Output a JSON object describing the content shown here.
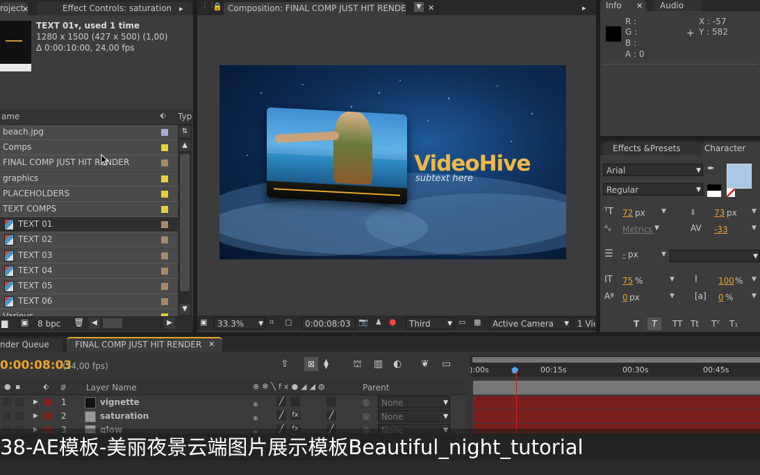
{
  "project_panel": {
    "tab_project": "roject",
    "tab_effect_controls": "Effect Controls: saturation",
    "selected_name": "TEXT 01▾, used 1 time",
    "selected_size": "1280 x 1500  (427 x 500) (1,00)",
    "selected_duration": "Δ 0:00:10:00, 24,00 fps",
    "col_name": "ame",
    "col_type": "Typ",
    "items": [
      {
        "label": "beach.jpg",
        "color": "#a9a9d8",
        "comp": false
      },
      {
        "label": "Comps",
        "color": "#e5cf3a",
        "comp": false
      },
      {
        "label": "FINAL COMP JUST HIT RENDER",
        "color": "#a88a6a",
        "comp": false
      },
      {
        "label": "graphics",
        "color": "#e5cf3a",
        "comp": false
      },
      {
        "label": "PLACEHOLDERS",
        "color": "#e5cf3a",
        "comp": false
      },
      {
        "label": "TEXT COMPS",
        "color": "#e5cf3a",
        "comp": false
      },
      {
        "label": "TEXT 01",
        "color": "#a88a6a",
        "comp": true
      },
      {
        "label": "TEXT 02",
        "color": "#a88a6a",
        "comp": true
      },
      {
        "label": "TEXT 03",
        "color": "#a88a6a",
        "comp": true
      },
      {
        "label": "TEXT 04",
        "color": "#a88a6a",
        "comp": true
      },
      {
        "label": "TEXT 05",
        "color": "#a88a6a",
        "comp": true
      },
      {
        "label": "TEXT 06",
        "color": "#a88a6a",
        "comp": true
      },
      {
        "label": "Various",
        "color": "#e5cf3a",
        "comp": false
      }
    ],
    "bpc_label": "8 bpc"
  },
  "composition_panel": {
    "tab_label": "Composition: FINAL COMP JUST HIT RENDER",
    "preview_title": "VideoHive",
    "preview_subtitle": "subtext here",
    "zoom": "33.3%",
    "timecode": "0:00:08:03",
    "resolution": "Third",
    "camera": "Active Camera",
    "views": "1 Vie"
  },
  "info_panel": {
    "tab_info": "Info",
    "tab_audio": "Audio",
    "r": "R :",
    "g": "G :",
    "b": "B :",
    "a": "A : 0",
    "x": "X : -57",
    "y": "Y : 582"
  },
  "character_panel": {
    "tab_effects": "Effects &Presets",
    "tab_character": "Character",
    "font": "Arial",
    "style": "Regular",
    "font_size": "72",
    "px1": "px",
    "leading": "73",
    "px2": "px",
    "kerning": "Metrics",
    "tracking": "-33",
    "stroke": "-",
    "px3": "px",
    "vscale": "75",
    "pct1": "%",
    "hscale": "100",
    "pct2": "%",
    "baseline": "0",
    "px4": "px",
    "tsume": "0",
    "pct3": "%",
    "fill_color": "#a7c9e8"
  },
  "timeline_panel": {
    "tab_render_queue": "nder Queue",
    "tab_comp": "FINAL COMP JUST HIT RENDER",
    "current_time": "0:00:08:03",
    "fps": "(24,00 fps)",
    "col_num": "#",
    "col_layer_name": "Layer Name",
    "col_parent": "Parent",
    "ruler": [
      "):00s",
      "00:15s",
      "00:30s",
      "00:45s"
    ],
    "layers": [
      {
        "num": "1",
        "name": "vignette",
        "parent": "None",
        "swatch": "#111111"
      },
      {
        "num": "2",
        "name": "saturation",
        "parent": "None",
        "swatch": "#999999"
      },
      {
        "num": "3",
        "name": "glow",
        "parent": "None",
        "swatch": "#999999"
      }
    ]
  },
  "caption": "38-AE模板-美丽夜景云端图片展示模板Beautiful_night_tutorial"
}
